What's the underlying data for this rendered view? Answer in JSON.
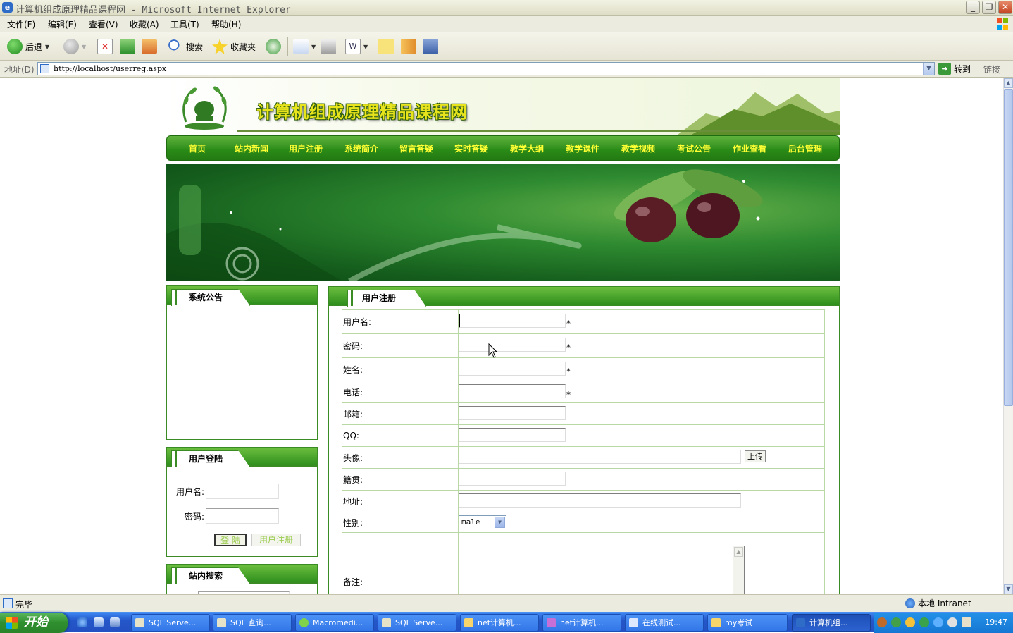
{
  "window": {
    "title": "计算机组成原理精品课程网 - Microsoft Internet Explorer",
    "buttons": {
      "minimize": "_",
      "maximize": "❐",
      "close": "✕"
    }
  },
  "menubar": [
    "文件(F)",
    "编辑(E)",
    "查看(V)",
    "收藏(A)",
    "工具(T)",
    "帮助(H)"
  ],
  "toolbar": {
    "back": "后退",
    "search": "搜索",
    "favorites": "收藏夹"
  },
  "address": {
    "label": "地址(D)",
    "url": "http://localhost/userreg.aspx",
    "go": "转到",
    "links": "链接"
  },
  "site": {
    "title": "计算机组成原理精品课程网",
    "nav": [
      "首页",
      "站内新闻",
      "用户注册",
      "系统简介",
      "留言答疑",
      "实时答疑",
      "教学大纲",
      "教学课件",
      "教学视频",
      "考试公告",
      "作业查看",
      "后台管理"
    ],
    "notice": {
      "title": "系统公告"
    },
    "login": {
      "title": "用户登陆",
      "username_label": "用户名:",
      "password_label": "密码:",
      "login_button": "登 陆",
      "register_button": "用户注册"
    },
    "search": {
      "title": "站内搜索"
    },
    "register": {
      "title": "用户注册",
      "fields": {
        "username": "用户名:",
        "password": "密码:",
        "name": "姓名:",
        "phone": "电话:",
        "email": "邮箱:",
        "qq": "QQ:",
        "avatar": "头像:",
        "hometown": "籍贯:",
        "address": "地址:",
        "gender": "性别:",
        "remark": "备注:"
      },
      "required_mark": "*",
      "upload_button": "上传",
      "gender_value": "male"
    }
  },
  "status": {
    "text": "完毕",
    "zone": "本地 Intranet"
  },
  "taskbar": {
    "start": "开始",
    "tasks": [
      "SQL Serve...",
      "SQL 查询...",
      "Macromedi...",
      "SQL Serve...",
      "net计算机...",
      "net计算机...",
      "在线测试...",
      "my考试",
      "计算机组..."
    ],
    "clock": "19:47"
  }
}
